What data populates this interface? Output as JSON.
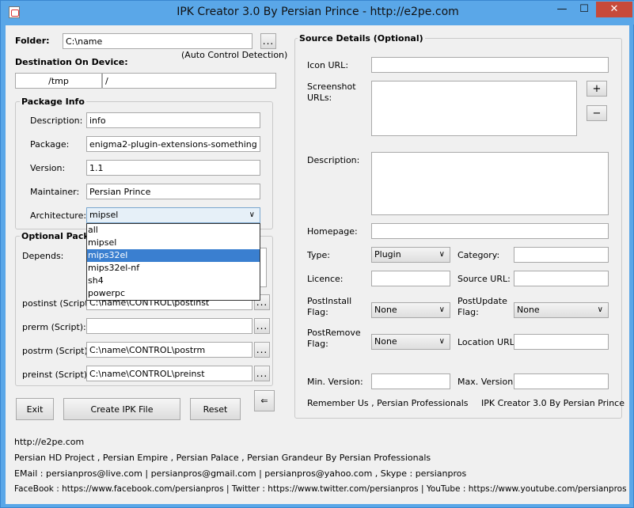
{
  "window": {
    "title": "IPK Creator 3.0 By Persian Prince - http://e2pe.com",
    "min": "—",
    "max": "☐",
    "close": "✕"
  },
  "left": {
    "folder_label": "Folder:",
    "folder_value": "C:\\name",
    "browse": "...",
    "auto_detect": "(Auto Control Detection)",
    "destination_label": "Destination On Device:",
    "destination_root": "/tmp",
    "destination_path": "/",
    "package_info": {
      "title": "Package Info",
      "description_label": "Description:",
      "description_value": "info",
      "package_label": "Package:",
      "package_value": "enigma2-plugin-extensions-something",
      "version_label": "Version:",
      "version_value": "1.1",
      "maintainer_label": "Maintainer:",
      "maintainer_value": "Persian Prince",
      "architecture_label": "Architecture:",
      "architecture_value": "mipsel",
      "architecture_options": [
        "all",
        "mipsel",
        "mips32el",
        "mips32el-nf",
        "sh4",
        "powerpc"
      ],
      "architecture_highlighted": "mips32el"
    },
    "optional": {
      "title": "Optional Packa",
      "depends_label": "Depends:",
      "postinst_label": "postinst (Script):",
      "postinst_value": "C:\\name\\CONTROL\\postinst",
      "prerm_label": "prerm (Script):",
      "prerm_value": "",
      "postrm_label": "postrm (Script):",
      "postrm_value": "C:\\name\\CONTROL\\postrm",
      "preinst_label": "preinst (Script):",
      "preinst_value": "C:\\name\\CONTROL\\preinst"
    },
    "buttons": {
      "exit": "Exit",
      "create": "Create IPK File",
      "reset": "Reset",
      "arrow": "⇐"
    }
  },
  "right": {
    "title": "Source Details (Optional)",
    "icon_url_label": "Icon URL:",
    "screenshot_label_1": "Screenshot",
    "screenshot_label_2": "URLs:",
    "plus": "+",
    "minus": "−",
    "description_label": "Description:",
    "homepage_label": "Homepage:",
    "type_label": "Type:",
    "type_value": "Plugin",
    "category_label": "Category:",
    "licence_label": "Licence:",
    "source_url_label": "Source URL:",
    "postinstall_label_1": "PostInstall",
    "postinstall_label_2": "Flag:",
    "postinstall_value": "None",
    "postupdate_label_1": "PostUpdate",
    "postupdate_label_2": "Flag:",
    "postupdate_value": "None",
    "postremove_label_1": "PostRemove",
    "postremove_label_2": "Flag:",
    "postremove_value": "None",
    "location_url_label": "Location URL:",
    "min_version_label": "Min. Version:",
    "max_version_label": "Max. Version:",
    "remember": "Remember Us , Persian Professionals",
    "brand": "IPK Creator 3.0 By Persian Prince"
  },
  "footer": {
    "line1": "http://e2pe.com",
    "line2": "Persian HD Project , Persian Empire , Persian Palace , Persian Grandeur By Persian Professionals",
    "line3": "EMail : persianpros@live.com | persianpros@gmail.com | persianpros@yahoo.com , Skype : persianpros",
    "line4": "FaceBook : https://www.facebook.com/persianpros | Twitter : https://www.twitter.com/persianpros | YouTube : https://www.youtube.com/persianpros"
  }
}
